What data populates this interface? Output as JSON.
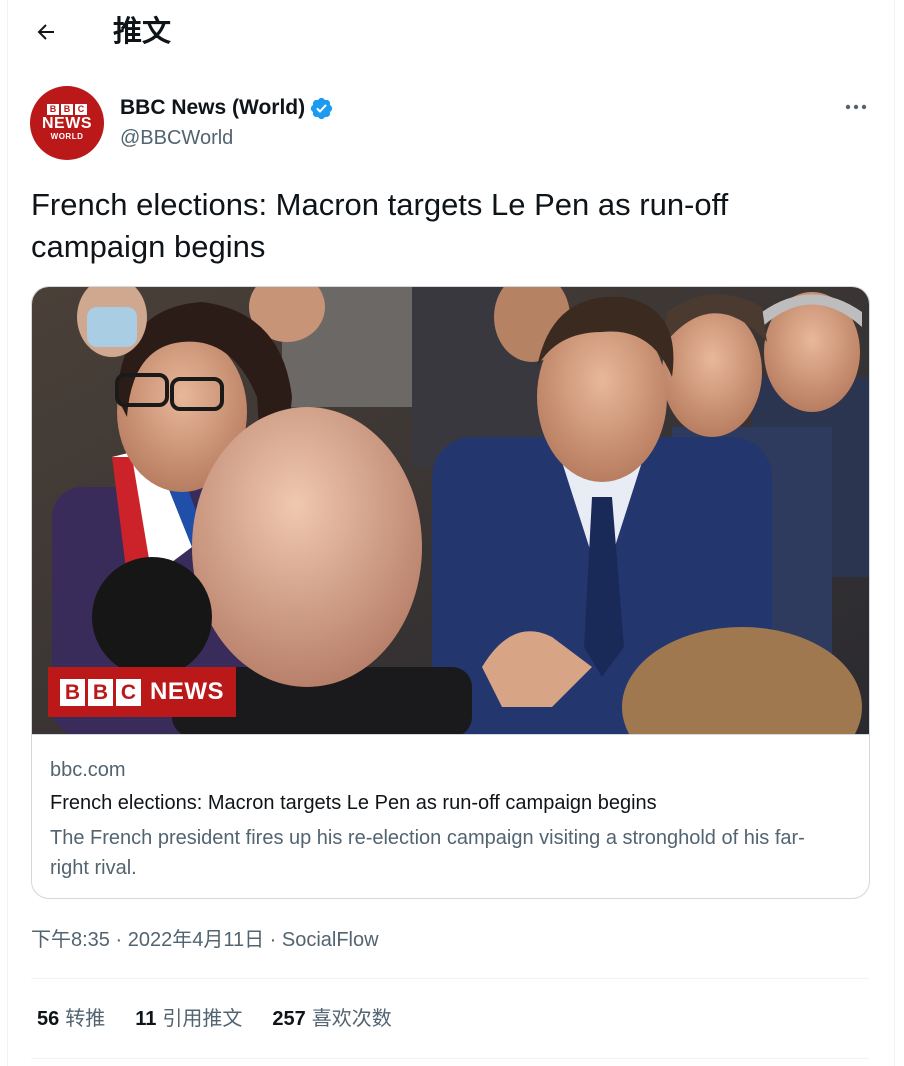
{
  "header": {
    "title": "推文"
  },
  "author": {
    "name": "BBC News (World)",
    "handle": "@BBCWorld",
    "avatar_text": {
      "blocks": [
        "B",
        "B",
        "C"
      ],
      "line2": "NEWS",
      "line3": "WORLD"
    }
  },
  "tweet": {
    "text": "French elections: Macron targets Le Pen as run-off campaign begins"
  },
  "card": {
    "badge": {
      "blocks": [
        "B",
        "B",
        "C"
      ],
      "word": "NEWS"
    },
    "domain": "bbc.com",
    "title": "French elections: Macron targets Le Pen as run-off campaign begins",
    "description": "The French president fires up his re-election campaign visiting a stronghold of his far-right rival."
  },
  "meta": {
    "time": "下午8:35 · 2022年4月11日",
    "separator": " · ",
    "source": "SocialFlow"
  },
  "stats": [
    {
      "count": "56",
      "label": "转推"
    },
    {
      "count": "11",
      "label": "引用推文"
    },
    {
      "count": "257",
      "label": "喜欢次数"
    }
  ],
  "colors": {
    "bbc_red": "#bb1919",
    "verified_blue": "#1d9bf0",
    "secondary_text": "#536471",
    "border": "#cfd9de"
  },
  "icons": {
    "back": "arrow-left-icon",
    "verified": "verified-badge-icon",
    "more": "more-dots-icon"
  }
}
